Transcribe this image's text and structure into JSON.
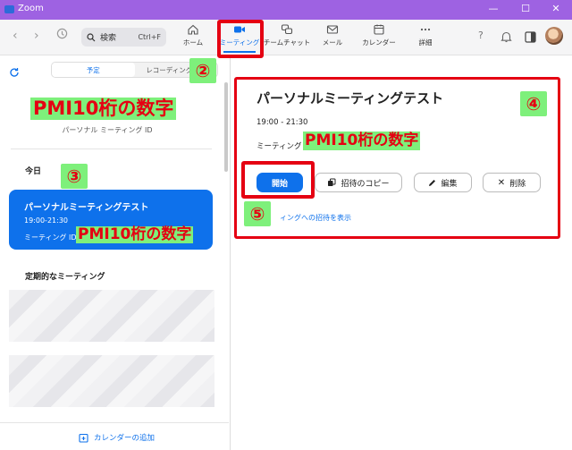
{
  "app": {
    "title": "Zoom"
  },
  "window": {
    "minimize": "—",
    "maximize": "☐",
    "close": "✕"
  },
  "search": {
    "label": "検索",
    "shortcut": "Ctrl+F"
  },
  "tabs": [
    {
      "label": "ホーム",
      "icon": "home-icon"
    },
    {
      "label": "ミーティング",
      "icon": "video-camera-icon",
      "active": true
    },
    {
      "label": "チームチャット",
      "icon": "chat-icon"
    },
    {
      "label": "メール",
      "icon": "mail-icon"
    },
    {
      "label": "カレンダー",
      "icon": "calendar-icon"
    },
    {
      "label": "詳細",
      "icon": "more-icon"
    }
  ],
  "left": {
    "segment": {
      "upcoming": "予定",
      "recorded": "レコーディング済み"
    },
    "pmi_overlay": "PMI10桁の数字",
    "pmi_caption": "パーソナル ミーティング ID",
    "today_label": "今日",
    "meeting": {
      "title": "パーソナルミーティングテスト",
      "time": "19:00-21:30",
      "id_label": "ミーティング ID:",
      "id_overlay": "PMI10桁の数字"
    },
    "recurring_label": "定期的なミーティング",
    "add_calendar": "カレンダーの追加"
  },
  "detail": {
    "title": "パーソナルミーティングテスト",
    "time": "19:00 - 21:30",
    "id_label": "ミーティング ID:",
    "id_overlay": "PMI10桁の数字",
    "start": "開始",
    "copy_invite": "招待のコピー",
    "edit": "編集",
    "delete": "削除",
    "show_invite": "ィングへの招待を表示"
  },
  "annotations": {
    "n2": "②",
    "n3": "③",
    "n4": "④",
    "n5": "⑤"
  },
  "colors": {
    "accent": "#0e71eb",
    "titlebar": "#9e62e2",
    "highlight": "#e50012",
    "marker": "#7ef07b"
  }
}
